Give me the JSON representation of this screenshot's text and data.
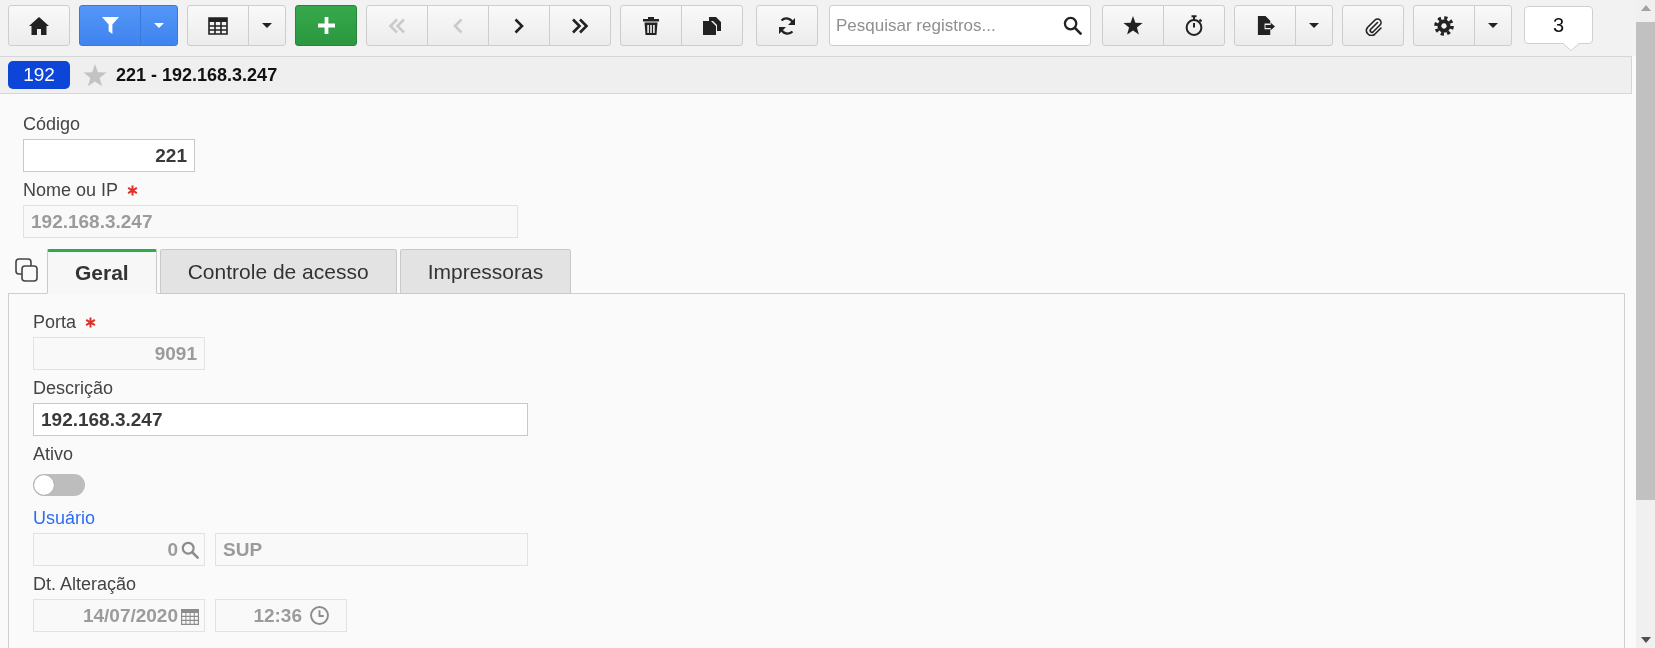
{
  "toolbar": {
    "left_groups": [
      {
        "buttons": [
          {
            "kind": "home",
            "disabled": false
          }
        ]
      },
      {
        "buttons": [
          {
            "kind": "filter",
            "disabled": false
          },
          {
            "kind": "dropdown",
            "disabled": false
          }
        ]
      },
      {
        "buttons": [
          {
            "kind": "grid",
            "disabled": false
          },
          {
            "kind": "dropdown",
            "disabled": false
          }
        ]
      },
      {
        "buttons": [
          {
            "kind": "add",
            "disabled": false
          }
        ]
      },
      {
        "buttons": [
          {
            "kind": "first",
            "disabled": true
          },
          {
            "kind": "previous",
            "disabled": true
          },
          {
            "kind": "next",
            "disabled": false
          },
          {
            "kind": "last",
            "disabled": false
          }
        ]
      },
      {
        "buttons": [
          {
            "kind": "delete",
            "disabled": false
          },
          {
            "kind": "copy",
            "disabled": false
          }
        ]
      },
      {
        "buttons": [
          {
            "kind": "refresh",
            "disabled": false
          }
        ]
      }
    ],
    "search": {
      "placeholder": "Pesquisar registros..."
    },
    "right_groups": [
      {
        "buttons": [
          {
            "kind": "favorite",
            "disabled": false
          },
          {
            "kind": "timer",
            "disabled": false
          }
        ]
      },
      {
        "buttons": [
          {
            "kind": "export",
            "disabled": false
          },
          {
            "kind": "dropdown",
            "disabled": false
          }
        ]
      },
      {
        "buttons": [
          {
            "kind": "attach",
            "disabled": false
          }
        ]
      },
      {
        "buttons": [
          {
            "kind": "settings",
            "disabled": false
          },
          {
            "kind": "dropdown",
            "disabled": false
          }
        ]
      }
    ],
    "counter": "3"
  },
  "header": {
    "record_id": "192",
    "favorite": false,
    "title": "221 - 192.168.3.247"
  },
  "record_fields": [
    {
      "kind": "number",
      "label": "Código",
      "required": false,
      "disabled": false,
      "value": "221"
    },
    {
      "kind": "text",
      "label": "Nome ou IP",
      "required": true,
      "disabled": true,
      "value": "192.168.3.247"
    }
  ],
  "tabs": [
    {
      "label": "Geral",
      "selected": true
    },
    {
      "label": "Controle de acesso",
      "selected": false
    },
    {
      "label": "Impressoras",
      "selected": false
    }
  ],
  "tab_fields": [
    {
      "kind": "number",
      "label": "Porta",
      "required": true,
      "disabled": true,
      "value": "9091"
    },
    {
      "kind": "text",
      "label": "Descrição",
      "required": false,
      "disabled": false,
      "value": "192.168.3.247"
    },
    {
      "kind": "toggle",
      "label": "Ativo",
      "required": false,
      "disabled": false,
      "on": false
    },
    {
      "kind": "lookup",
      "label": "Usuário",
      "required": false,
      "disabled": true,
      "code": "0",
      "name": "SUP"
    },
    {
      "kind": "datetime",
      "label": "Dt. Alteração",
      "required": false,
      "disabled": true,
      "date": "14/07/2020",
      "time": "12:36"
    }
  ]
}
